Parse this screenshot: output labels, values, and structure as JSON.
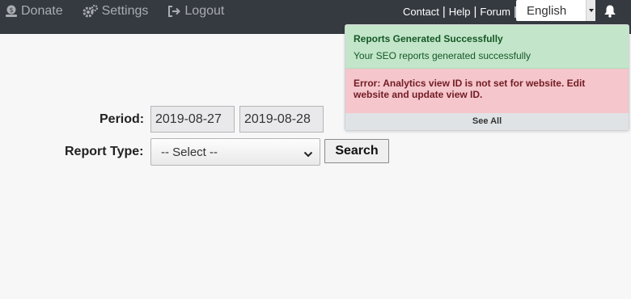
{
  "nav": {
    "items": [
      {
        "label": "Donate",
        "icon": "donate-icon"
      },
      {
        "label": "Settings",
        "icon": "gears-icon"
      },
      {
        "label": "Logout",
        "icon": "sign-out-icon"
      }
    ],
    "links": [
      "Contact",
      "Help",
      "Forum"
    ],
    "separator": "|",
    "language": "English"
  },
  "notifications": {
    "success_title": "Reports Generated Successfully",
    "success_message": "Your SEO reports generated successfully",
    "error_message": "Error: Analytics view ID is not set for website. Edit website and update view ID.",
    "see_all": "See All"
  },
  "form": {
    "period_label": "Period:",
    "start_date": "2019-08-27",
    "end_date": "2019-08-28",
    "report_type_label": "Report Type:",
    "report_type_selected": "-- Select --",
    "search_label": "Search"
  },
  "colors": {
    "topbar": "#343a40",
    "success_bg": "#c3e6cb",
    "error_bg": "#f5c6cb"
  }
}
